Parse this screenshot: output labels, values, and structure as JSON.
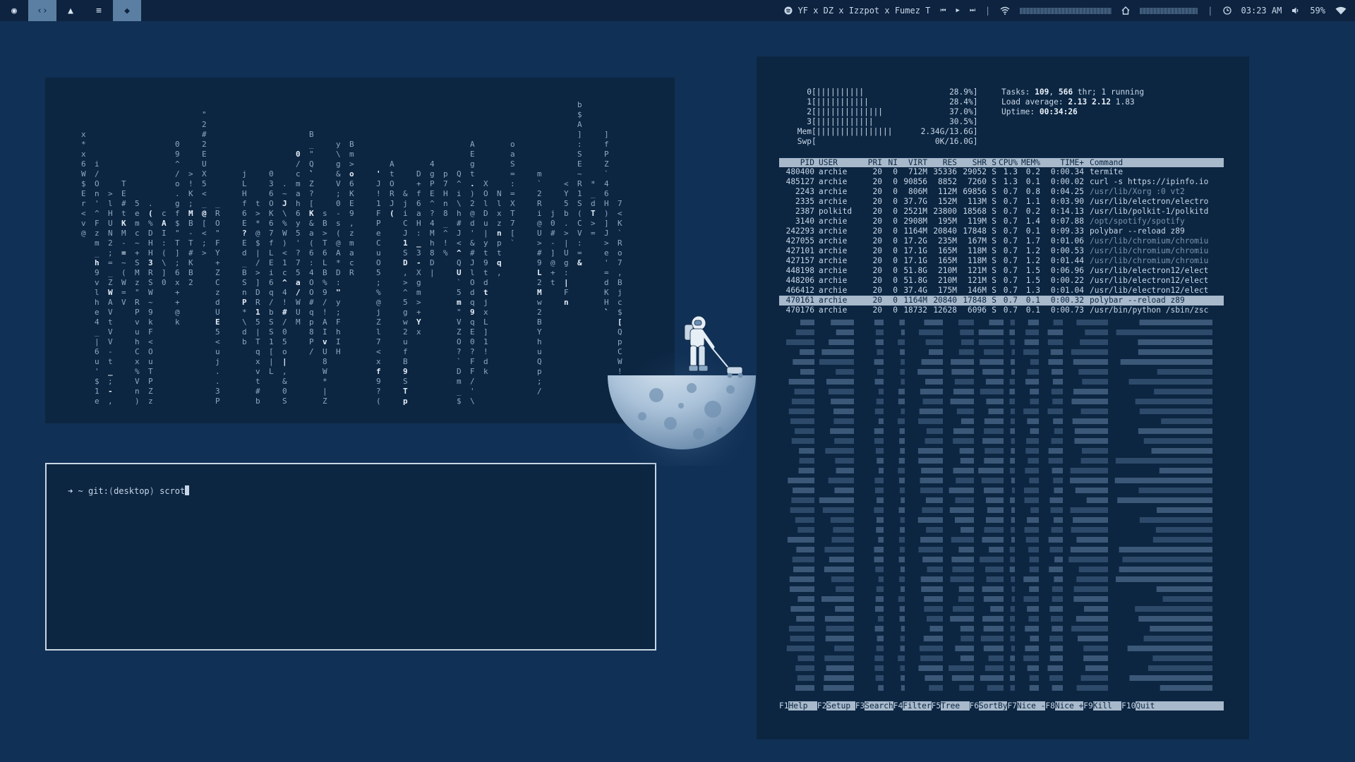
{
  "topbar": {
    "workspaces": [
      {
        "icon": "chrome-icon",
        "glyph": "◉"
      },
      {
        "icon": "code-icon",
        "glyph": "‹›"
      },
      {
        "icon": "graduation-cap-icon",
        "glyph": "▲"
      },
      {
        "icon": "spotify-icon",
        "glyph": "≡"
      },
      {
        "icon": "shield-icon",
        "glyph": "◆"
      }
    ],
    "now_playing": "YF x DZ x Izzpot x Fumez T",
    "media_prev": "⏮",
    "media_play": "▶",
    "media_next": "⏭",
    "divider": "|",
    "time": "03:23 AM",
    "volume": "59%"
  },
  "terminal": {
    "prompt_arrow": "➜",
    "prompt_dir": "~",
    "git_label": "git:",
    "branch_open": "(",
    "branch": "desktop",
    "branch_close": ")",
    "command": "scrot"
  },
  "htop": {
    "cpu": [
      {
        "label": "0",
        "bars": "||||||||||",
        "pct": "28.9%"
      },
      {
        "label": "1",
        "bars": "|||||||||||",
        "pct": "28.4%"
      },
      {
        "label": "2",
        "bars": "||||||||||||||",
        "pct": "37.0%"
      },
      {
        "label": "3",
        "bars": "||||||||||||",
        "pct": "30.5%"
      }
    ],
    "mem": {
      "label": "Mem",
      "bars": "||||||||||||||||",
      "value": "2.34G/13.6G"
    },
    "swp": {
      "label": "Swp",
      "bars": "",
      "value": "0K/16.0G"
    },
    "tasks_label": "Tasks:",
    "tasks": "109",
    "thr": "566",
    "thr_suffix": "thr; 1 running",
    "load_label": "Load average:",
    "load1": "2.13",
    "load5": "2.12",
    "load15": "1.83",
    "uptime_label": "Uptime:",
    "uptime": "00:34:26",
    "columns": [
      "PID",
      "USER",
      "PRI",
      "NI",
      "VIRT",
      "RES",
      "SHR",
      "S",
      "CPU%",
      "MEM%",
      "TIME+",
      "Command"
    ],
    "processes": [
      {
        "pid": "480400",
        "user": "archie",
        "pri": "20",
        "ni": "0",
        "virt": "712M",
        "res": "35336",
        "shr": "29052",
        "s": "S",
        "cpu": "1.3",
        "mem": "0.2",
        "time": "0:00.34",
        "cmd": "termite"
      },
      {
        "pid": "485127",
        "user": "archie",
        "pri": "20",
        "ni": "0",
        "virt": "90856",
        "res": "8852",
        "shr": "7260",
        "s": "S",
        "cpu": "1.3",
        "mem": "0.1",
        "time": "0:00.02",
        "cmd": "curl -s https://ipinfo.io"
      },
      {
        "pid": "2243",
        "user": "archie",
        "pri": "20",
        "ni": "0",
        "virt": "806M",
        "res": "112M",
        "shr": "69856",
        "s": "S",
        "cpu": "0.7",
        "mem": "0.8",
        "time": "0:04.25",
        "cmd": "/usr/lib/Xorg :0 vt2"
      },
      {
        "pid": "2335",
        "user": "archie",
        "pri": "20",
        "ni": "0",
        "virt": "37.7G",
        "res": "152M",
        "shr": "113M",
        "s": "S",
        "cpu": "0.7",
        "mem": "1.1",
        "time": "0:03.90",
        "cmd": "/usr/lib/electron/electro"
      },
      {
        "pid": "2387",
        "user": "polkitd",
        "pri": "20",
        "ni": "0",
        "virt": "2521M",
        "res": "23800",
        "shr": "18568",
        "s": "S",
        "cpu": "0.7",
        "mem": "0.2",
        "time": "0:14.13",
        "cmd": "/usr/lib/polkit-1/polkitd"
      },
      {
        "pid": "3140",
        "user": "archie",
        "pri": "20",
        "ni": "0",
        "virt": "2908M",
        "res": "195M",
        "shr": "119M",
        "s": "S",
        "cpu": "0.7",
        "mem": "1.4",
        "time": "0:07.88",
        "cmd": "/opt/spotify/spotify"
      },
      {
        "pid": "242293",
        "user": "archie",
        "pri": "20",
        "ni": "0",
        "virt": "1164M",
        "res": "20840",
        "shr": "17848",
        "s": "S",
        "cpu": "0.7",
        "mem": "0.1",
        "time": "0:09.33",
        "cmd": "polybar --reload z89"
      },
      {
        "pid": "427055",
        "user": "archie",
        "pri": "20",
        "ni": "0",
        "virt": "17.2G",
        "res": "235M",
        "shr": "167M",
        "s": "S",
        "cpu": "0.7",
        "mem": "1.7",
        "time": "0:01.06",
        "cmd": "/usr/lib/chromium/chromiu"
      },
      {
        "pid": "427101",
        "user": "archie",
        "pri": "20",
        "ni": "0",
        "virt": "17.1G",
        "res": "165M",
        "shr": "118M",
        "s": "S",
        "cpu": "0.7",
        "mem": "1.2",
        "time": "0:00.53",
        "cmd": "/usr/lib/chromium/chromiu"
      },
      {
        "pid": "427157",
        "user": "archie",
        "pri": "20",
        "ni": "0",
        "virt": "17.1G",
        "res": "165M",
        "shr": "118M",
        "s": "S",
        "cpu": "0.7",
        "mem": "1.2",
        "time": "0:01.44",
        "cmd": "/usr/lib/chromium/chromiu"
      },
      {
        "pid": "448198",
        "user": "archie",
        "pri": "20",
        "ni": "0",
        "virt": "51.8G",
        "res": "210M",
        "shr": "121M",
        "s": "S",
        "cpu": "0.7",
        "mem": "1.5",
        "time": "0:06.96",
        "cmd": "/usr/lib/electron12/elect"
      },
      {
        "pid": "448206",
        "user": "archie",
        "pri": "20",
        "ni": "0",
        "virt": "51.8G",
        "res": "210M",
        "shr": "121M",
        "s": "S",
        "cpu": "0.7",
        "mem": "1.5",
        "time": "0:00.22",
        "cmd": "/usr/lib/electron12/elect"
      },
      {
        "pid": "466412",
        "user": "archie",
        "pri": "20",
        "ni": "0",
        "virt": "37.4G",
        "res": "175M",
        "shr": "146M",
        "s": "S",
        "cpu": "0.7",
        "mem": "1.3",
        "time": "0:01.04",
        "cmd": "/usr/lib/electron12/elect"
      },
      {
        "pid": "470161",
        "user": "archie",
        "pri": "20",
        "ni": "0",
        "virt": "1164M",
        "res": "20840",
        "shr": "17848",
        "s": "S",
        "cpu": "0.7",
        "mem": "0.1",
        "time": "0:00.32",
        "cmd": "polybar --reload z89",
        "selected": true
      },
      {
        "pid": "470176",
        "user": "archie",
        "pri": "20",
        "ni": "0",
        "virt": "18732",
        "res": "12628",
        "shr": "6096",
        "s": "S",
        "cpu": "0.7",
        "mem": "0.1",
        "time": "0:00.73",
        "cmd": "/usr/bin/python /sbin/zsc"
      }
    ],
    "fkeys": [
      {
        "key": "F1",
        "label": "Help  "
      },
      {
        "key": "F2",
        "label": "Setup "
      },
      {
        "key": "F3",
        "label": "Search"
      },
      {
        "key": "F4",
        "label": "Filter"
      },
      {
        "key": "F5",
        "label": "Tree  "
      },
      {
        "key": "F6",
        "label": "SortBy"
      },
      {
        "key": "F7",
        "label": "Nice -"
      },
      {
        "key": "F8",
        "label": "Nice +"
      },
      {
        "key": "F9",
        "label": "Kill  "
      },
      {
        "key": "F10",
        "label": "Quit  "
      }
    ]
  },
  "colors": {
    "desktop": "#113055",
    "panel": "#0c2642",
    "accent": "#a7b9cb",
    "text": "#c8d7e7"
  }
}
